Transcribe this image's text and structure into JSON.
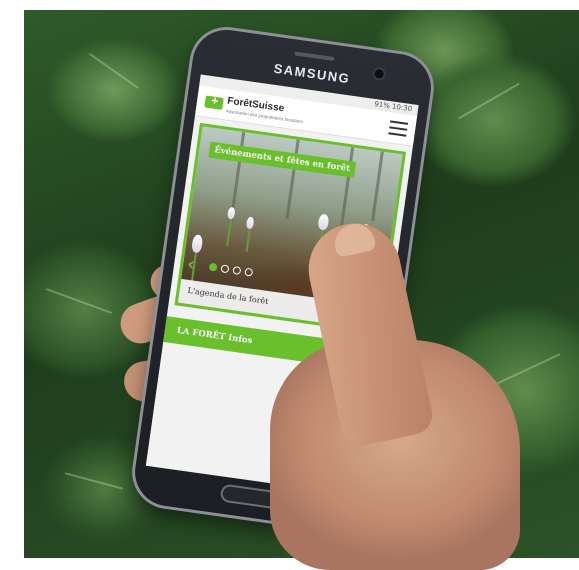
{
  "phone": {
    "brand": "SAMSUNG",
    "status_bar": "91% 10:30"
  },
  "site": {
    "logo_name": "ForêtSuisse",
    "logo_tagline": "Association des propriétaires forestiers",
    "menu_icon": "hamburger-menu-icon"
  },
  "hero": {
    "title": "Événements et fêtes en forêt",
    "link_label": "L'agenda de la forêt",
    "prev_arrow": "‹",
    "slide_count": 4,
    "active_slide": 1
  },
  "section": {
    "heading": "LA FORÊT Infos"
  },
  "colors": {
    "accent": "#6abf2c",
    "foliage": "#2f5a2a"
  }
}
